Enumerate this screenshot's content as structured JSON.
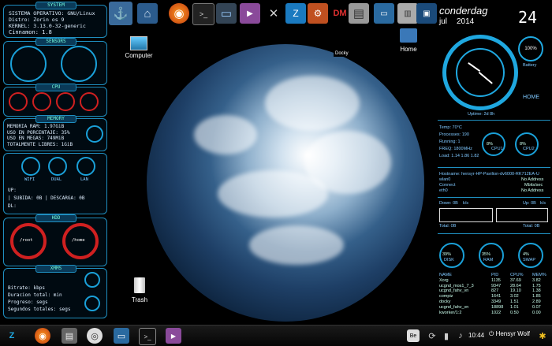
{
  "left_conky": {
    "system_title": "SYSTEM",
    "system_lines": [
      "SISTEMA OPERATIVO: GNU/Linux",
      "Distro: Zorin os 9",
      "KERNEL: 3.13.0-32-generic",
      "Cinnamon: 1.8"
    ],
    "sensors_title": "SENSORS",
    "cpu_title": "CPU",
    "memory_title": "MEMORY",
    "memory_lines": [
      "MEMORIA RAM: 1.97GiB",
      "USO EN PORCENTAJE: 35%",
      "USO EN MEGAS: 749MiB",
      "TOTALMENTE LIBRES: 1GiB"
    ],
    "net_labels": [
      "WIFI",
      "DUAL",
      "LAN"
    ],
    "net_lines": [
      "UP:",
      "| SUBIDA: 0B   | DESCARGA: 0B",
      "DL:"
    ],
    "hdd_title": "HDD",
    "hdd_labels": [
      "/root",
      "/home"
    ],
    "xmms_title": "XMMS",
    "xmms_lines": [
      "Bitrate:  kbps",
      "Duracion total:  min",
      "Progreso:  segs",
      "Segundos totales:  segs"
    ]
  },
  "dock": {
    "docky_label": "Docky",
    "icons": [
      "anchor-icon",
      "home-folder-icon",
      "firefox-icon",
      "terminal-icon",
      "computer-icon",
      "media-icon",
      "tools-icon",
      "zorin-icon",
      "settings-icon",
      "dm-icon",
      "drive-icon",
      "window-icon",
      "files-icon",
      "monitor-icon"
    ],
    "dm_text": "DM"
  },
  "desktop": {
    "computer_label": "Computer",
    "home_label": "Home",
    "trash_label": "Trash"
  },
  "right_conky": {
    "brand": "conderdag",
    "month": "jul",
    "year": "2014",
    "day": "24",
    "battery_pct": "100%",
    "battery_label": "Battery",
    "home_label": "HOME",
    "uptime": "Uptime: 2d 8h",
    "temp": "Temp: 70°C",
    "processes": "Processes: 190",
    "running": "Running: 1",
    "freq": "FREQ: 1800MHz",
    "load": "Load: 1.14 1.86 1.82",
    "cpu1": "CPU1",
    "cpu2": "CPU2",
    "cpu1_pct": "8%",
    "cpu2_pct": "8%",
    "hostname": "Hostname: hensyr-HP-Pavilion-dv6000-RK712EA-U",
    "wlan0": "wlan0",
    "wlan0_val": "No Address",
    "connect": "Connect",
    "connect_val": "Mbits/sec",
    "eth0": "eth0",
    "eth0_val": "No Address",
    "down": "Down: 0B",
    "down_unit": "k/s",
    "up": "Up: 0B",
    "up_unit": "k/s",
    "total_down": "Total: 0B",
    "total_up": "Total: 0B",
    "disk_pct": "39%",
    "disk_label": "DISK",
    "ram_pct": "35%",
    "ram_label": "RAM",
    "swap_pct": "4%",
    "swap_label": "SWAP",
    "proc_headers": [
      "NAME",
      "PID",
      "CPU%",
      "MEM%"
    ],
    "procs": [
      [
        "Xorg",
        "1135",
        "37.69",
        "3.82"
      ],
      [
        "ucgnd_mos1_7_3",
        "9347",
        "28.64",
        "1.75"
      ],
      [
        "ucgnd_fahv_vn",
        "827",
        "19.10",
        "1.38"
      ],
      [
        "compiz",
        "1641",
        "3.02",
        "1.85"
      ],
      [
        "docky",
        "3349",
        "1.51",
        "2.89"
      ],
      [
        "ucgnd_fahv_vn",
        "18898",
        "1.01",
        "0.07"
      ],
      [
        "kworker/1:2",
        "1022",
        "0.50",
        "0.00"
      ]
    ]
  },
  "taskbar": {
    "clock": "10:44",
    "user": "Hensyr Wolf",
    "be_label": "Be"
  },
  "colors": {
    "accent": "#1fa8e0",
    "red": "#d02020"
  }
}
